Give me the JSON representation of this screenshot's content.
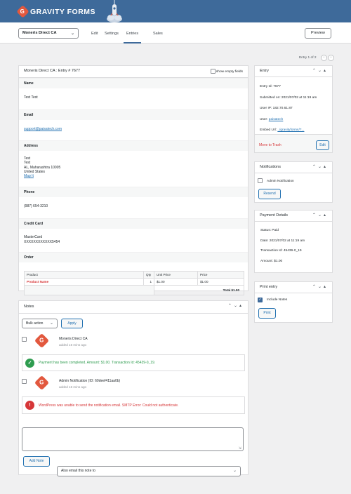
{
  "header": {
    "brand": "GRAVITY FORMS",
    "logo_letter": "G"
  },
  "toolbar": {
    "form_name": "Moneris Direct CA",
    "tabs": [
      "Edit",
      "Settings",
      "Entries",
      "Sales"
    ],
    "preview_label": "Preview"
  },
  "pager": {
    "text": "Entry 1 of 2"
  },
  "entry_panel": {
    "title": "Moneris Direct CA : Entry # 7677",
    "show_empty_label": "show empty fields",
    "fields": {
      "name_label": "Name",
      "name_value": "Test Test",
      "email_label": "Email",
      "email_value": "support@paisatech.com",
      "address_label": "Address",
      "address_lines": [
        "Test",
        "Test",
        "AL, Maharashtra 10005",
        "United States"
      ],
      "map_link": "Map It",
      "phone_label": "Phone",
      "phone_value": "(987) 654-3210",
      "card_label": "Credit Card",
      "card_type": "MasterCard",
      "card_number": "XXXXXXXXXXXX5454",
      "order_label": "Order"
    },
    "order": {
      "headers": [
        "Product",
        "Qty",
        "Unit Price",
        "Price"
      ],
      "product_name": "Product Name",
      "qty": "1",
      "unit_price": "$1.00",
      "price": "$1.00",
      "total_label": "Total",
      "total_value": "$1.00"
    }
  },
  "notes_panel": {
    "title": "Notes",
    "bulk_action": "Bulk action",
    "apply_label": "Apply",
    "notes": [
      {
        "author": "Moneris Direct CA",
        "time": "added 16 mins ago",
        "message": "Payment has been completed. Amount: $1.00. Transaction Id: 45439-0_19.",
        "status": "success"
      },
      {
        "author": "Admin Notification (ID: 60deef411aa0b)",
        "time": "added 16 mins ago",
        "message": "WordPress was unable to send the notification email. SMTP Error: Could not authenticate.",
        "status": "error"
      }
    ],
    "add_note_label": "Add Note",
    "email_select": "Also email this note to"
  },
  "sidebar": {
    "entry": {
      "title": "Entry",
      "entry_id": "Entry Id: 7677",
      "submitted": "Submitted on: 2021/07/02 at 11:19 am",
      "user_ip": "User IP: 182.70.61.87",
      "user_label": "User: ",
      "user_link": "paisatech",
      "embed_label": "Embed Url: ",
      "embed_link": "../gravityforms/?...",
      "trash_label": "Move to Trash",
      "edit_label": "Edit"
    },
    "notifications": {
      "title": "Notifications",
      "item": "Admin Notification",
      "resend_label": "Resend"
    },
    "payment": {
      "title": "Payment Details",
      "status": "Status: Paid",
      "date": "Date: 2021/07/02 at 11:19 am",
      "transaction": "Transaction Id: 45439-0_19",
      "amount": "Amount: $1.00"
    },
    "print": {
      "title": "Print entry",
      "include_notes": "Include Notes",
      "print_label": "Print"
    }
  },
  "colors": {
    "brand_blue": "#3e6a9a",
    "brand_orange": "#e2583e",
    "link": "#2271b1",
    "danger": "#d63638",
    "success": "#2e9c4f"
  }
}
